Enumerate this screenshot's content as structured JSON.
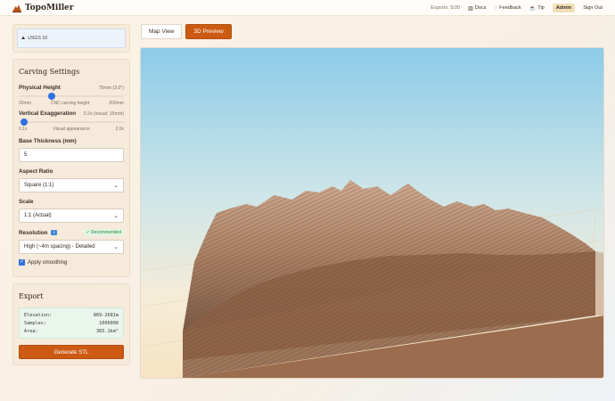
{
  "app": {
    "name": "TopoMiller"
  },
  "nav": {
    "exports": "Exports: 5/20",
    "docs": "Docs",
    "feedback": "Feedback",
    "tip": "Tip",
    "admin": "Admin",
    "signout": "Sign Out"
  },
  "source": {
    "label": "USGS 10"
  },
  "carving": {
    "title": "Carving Settings",
    "physical_height": {
      "label": "Physical Height",
      "value": "75mm (3.0\")",
      "min": "20mm",
      "max": "200mm",
      "caption": "CNC carving height",
      "level": 0.31
    },
    "vertical_exaggeration": {
      "label": "Vertical Exaggeration",
      "value": "0.2x (visual: 15mm)",
      "min": "0.1x",
      "max": "2.0x",
      "caption": "Visual appearance",
      "level": 0.05
    },
    "base_thickness": {
      "label": "Base Thickness (mm)",
      "value": "5"
    },
    "aspect_ratio": {
      "label": "Aspect Ratio",
      "value": "Square (1:1)"
    },
    "scale": {
      "label": "Scale",
      "value": "1:1 (Actual)"
    },
    "resolution": {
      "label": "Resolution",
      "info_glyph": "i",
      "badge": "✓ Recommended",
      "value": "High (~4m spacing) - Detailed"
    },
    "smoothing": {
      "label": "Apply smoothing",
      "checked": true
    }
  },
  "export": {
    "title": "Export",
    "stats": [
      {
        "label": "Elevation:",
        "value": "869-2681m"
      },
      {
        "label": "Samples:",
        "value": "1000000"
      },
      {
        "label": "Area:",
        "value": "365.1km²"
      }
    ],
    "button": "Generate STL"
  },
  "tabs": [
    {
      "label": "Map View",
      "active": false
    },
    {
      "label": "3D Preview",
      "active": true
    }
  ],
  "colors": {
    "accent": "#cc5a12",
    "slider": "#2f6fe0",
    "terrain": "#b08468",
    "base": "#a87858",
    "sky_top": "#8ccbe8",
    "floor": "#f7e9cf"
  }
}
